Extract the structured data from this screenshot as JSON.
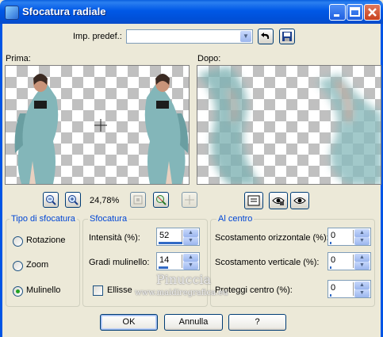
{
  "window": {
    "title": "Sfocatura radiale"
  },
  "preset": {
    "label": "Imp. predef.:",
    "value": ""
  },
  "previews": {
    "before_label": "Prima:",
    "after_label": "Dopo:"
  },
  "zoom": {
    "level": "24,78%"
  },
  "blur_type": {
    "title": "Tipo di sfocatura",
    "options": [
      "Rotazione",
      "Zoom",
      "Mulinello"
    ],
    "selected": "Mulinello"
  },
  "blur": {
    "title": "Sfocatura",
    "intensity_label": "Intensità (%):",
    "intensity_value": "52",
    "twist_label": "Gradi mulinello:",
    "twist_value": "14",
    "ellipse_label": "Ellisse",
    "ellipse_checked": false
  },
  "center": {
    "title": "Al centro",
    "h_offset_label": "Scostamento orizzontale (%):",
    "h_offset_value": "0",
    "v_offset_label": "Scostamento verticale (%):",
    "v_offset_value": "0",
    "protect_label": "Proteggi centro (%):",
    "protect_value": "0"
  },
  "buttons": {
    "ok": "OK",
    "cancel": "Annulla",
    "help": "?"
  },
  "watermark": {
    "line1": "Pinuccia",
    "line2": "www.maidiregrafica.eu"
  },
  "colors": {
    "title_bar": "#0058e6",
    "group_title": "#0046d5",
    "dress": "#7fb2b4"
  }
}
